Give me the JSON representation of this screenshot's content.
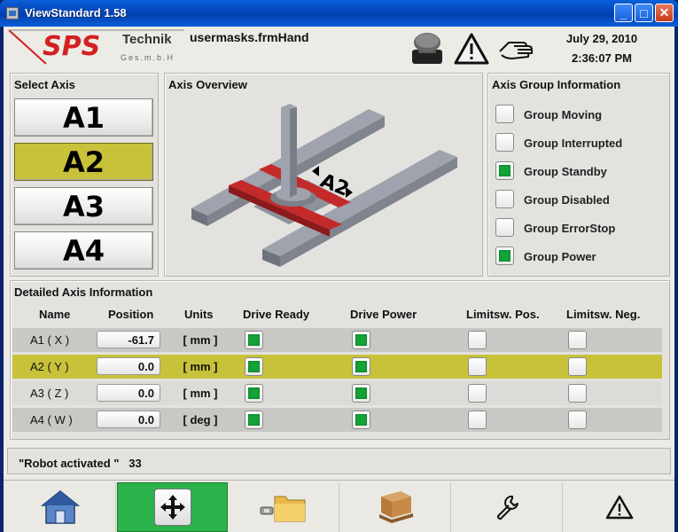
{
  "window": {
    "title": "ViewStandard 1.58",
    "minimize": "_",
    "maximize": "□",
    "close": "✕"
  },
  "header": {
    "logo_main": "SPS",
    "logo_technik": "Technik",
    "logo_gmbh": "Ges.m.b.H",
    "file_name": "usermasks.frmHand",
    "date": "July 29, 2010",
    "time": "2:36:07 PM",
    "icons": [
      "emergency-stop-icon",
      "warning-icon",
      "hand-mode-icon"
    ]
  },
  "select_axis": {
    "title": "Select Axis",
    "buttons": [
      "A1",
      "A2",
      "A3",
      "A4"
    ],
    "selected": "A2"
  },
  "axis_overview": {
    "title": "Axis Overview",
    "label": "A2"
  },
  "group_info": {
    "title": "Axis Group Information",
    "items": [
      {
        "label": "Group Moving",
        "on": false
      },
      {
        "label": "Group Interrupted",
        "on": false
      },
      {
        "label": "Group Standby",
        "on": true
      },
      {
        "label": "Group Disabled",
        "on": false
      },
      {
        "label": "Group ErrorStop",
        "on": false
      },
      {
        "label": "Group Power",
        "on": true
      }
    ]
  },
  "detail": {
    "title": "Detailed Axis Information",
    "columns": [
      "Name",
      "Position",
      "Units",
      "Drive Ready",
      "Drive Power",
      "Limitsw. Pos.",
      "Limitsw. Neg."
    ],
    "rows": [
      {
        "name": "A1 ( X )",
        "position": "-61.7",
        "units": "[ mm ]",
        "drive_ready": true,
        "drive_power": true,
        "lim_pos": false,
        "lim_neg": false
      },
      {
        "name": "A2 ( Y )",
        "position": "0.0",
        "units": "[ mm ]",
        "drive_ready": true,
        "drive_power": true,
        "lim_pos": false,
        "lim_neg": false
      },
      {
        "name": "A3 ( Z )",
        "position": "0.0",
        "units": "[ mm ]",
        "drive_ready": true,
        "drive_power": true,
        "lim_pos": false,
        "lim_neg": false
      },
      {
        "name": "A4 ( W )",
        "position": "0.0",
        "units": "[ deg ]",
        "drive_ready": true,
        "drive_power": true,
        "lim_pos": false,
        "lim_neg": false
      }
    ]
  },
  "status": {
    "message": "\"Robot activated \"",
    "code": "33"
  },
  "nav": {
    "items": [
      "home-icon",
      "move-icon",
      "folder-icon",
      "pallet-icon",
      "wrench-icon",
      "warning-icon"
    ],
    "active": "move-icon"
  },
  "colors": {
    "selected_row": "#c7c23a",
    "indicator_on": "#13a337",
    "nav_active": "#2bb24b",
    "logo_red": "#d42020"
  }
}
